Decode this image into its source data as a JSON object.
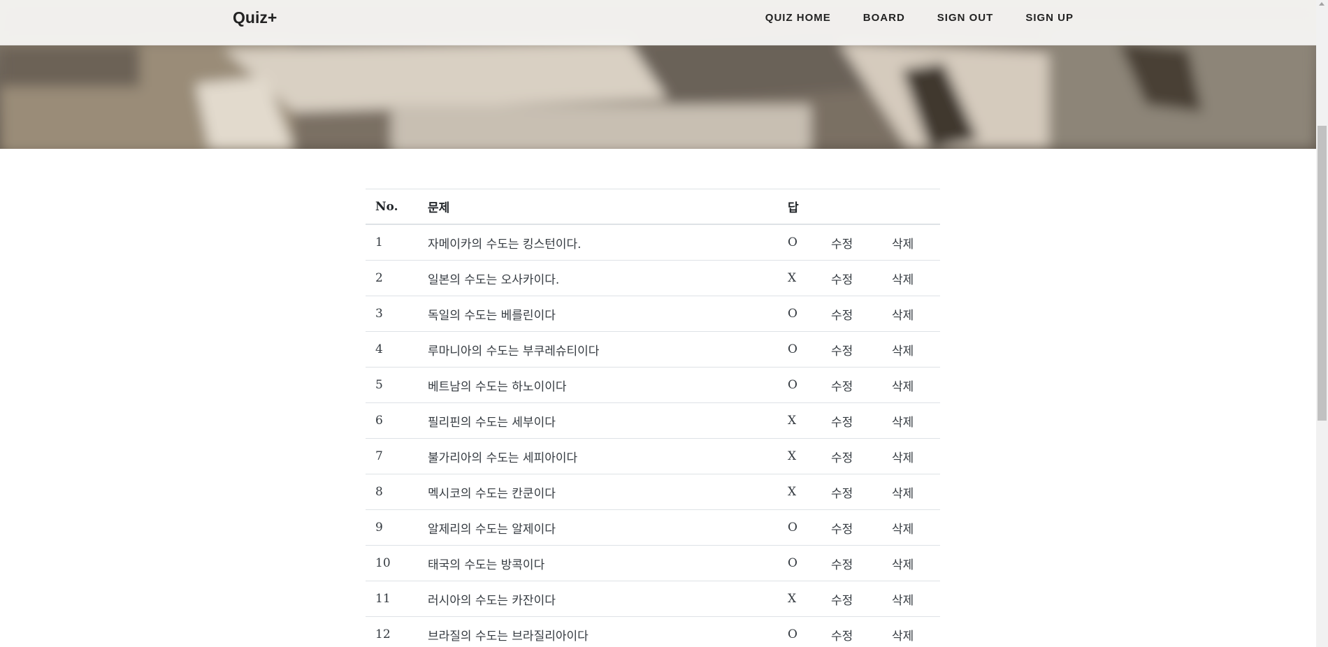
{
  "brand": "Quiz+",
  "nav": [
    {
      "label": "QUIZ HOME"
    },
    {
      "label": "BOARD"
    },
    {
      "label": "SIGN OUT"
    },
    {
      "label": "SIGN UP"
    }
  ],
  "table": {
    "headers": {
      "no": "No.",
      "question": "문제",
      "answer": "답"
    },
    "edit_label": "수정",
    "delete_label": "삭제",
    "rows": [
      {
        "no": "1",
        "question": "자메이카의 수도는 킹스턴이다.",
        "answer": "O"
      },
      {
        "no": "2",
        "question": "일본의 수도는 오사카이다.",
        "answer": "X"
      },
      {
        "no": "3",
        "question": "독일의 수도는 베를린이다",
        "answer": "O"
      },
      {
        "no": "4",
        "question": "루마니아의 수도는 부쿠레슈티이다",
        "answer": "O"
      },
      {
        "no": "5",
        "question": "베트남의 수도는 하노이이다",
        "answer": "O"
      },
      {
        "no": "6",
        "question": "필리핀의 수도는 세부이다",
        "answer": "X"
      },
      {
        "no": "7",
        "question": "불가리아의 수도는 세피아이다",
        "answer": "X"
      },
      {
        "no": "8",
        "question": "멕시코의 수도는 칸쿤이다",
        "answer": "X"
      },
      {
        "no": "9",
        "question": "알제리의 수도는 알제이다",
        "answer": "O"
      },
      {
        "no": "10",
        "question": "태국의 수도는 방콕이다",
        "answer": "O"
      },
      {
        "no": "11",
        "question": "러시아의 수도는 카잔이다",
        "answer": "X"
      },
      {
        "no": "12",
        "question": "브라질의 수도는 브라질리아이다",
        "answer": "O"
      }
    ]
  }
}
